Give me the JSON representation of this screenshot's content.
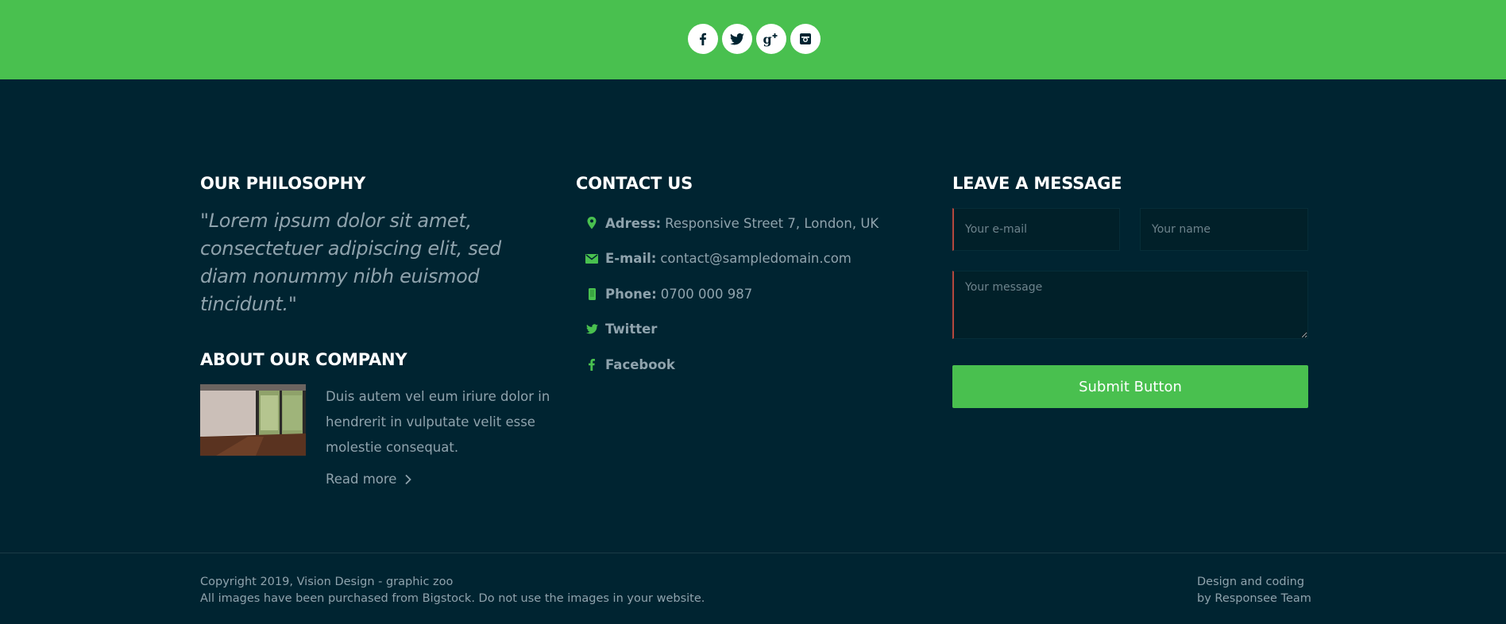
{
  "social": {
    "icons": [
      "facebook-icon",
      "twitter-icon",
      "google-plus-icon",
      "instagram-icon"
    ]
  },
  "philosophy": {
    "title": "OUR PHILOSOPHY",
    "quote": "\"Lorem ipsum dolor sit amet, consectetuer adipiscing elit, sed diam nonummy nibh euismod tincidunt.\""
  },
  "about": {
    "title": "ABOUT OUR COMPANY",
    "text": "Duis autem vel eum iriure dolor in hendrerit in vulputate velit esse molestie consequat.",
    "read_more": "Read more"
  },
  "contact": {
    "title": "CONTACT US",
    "address_label": "Adress:",
    "address_value": "Responsive Street 7, London, UK",
    "email_label": "E-mail:",
    "email_value": "contact@sampledomain.com",
    "phone_label": "Phone:",
    "phone_value": "0700 000 987",
    "twitter": "Twitter",
    "facebook": "Facebook"
  },
  "message": {
    "title": "LEAVE A MESSAGE",
    "email_placeholder": "Your e-mail",
    "name_placeholder": "Your name",
    "message_placeholder": "Your message",
    "submit": "Submit Button"
  },
  "bottom": {
    "copyright_line1": "Copyright 2019, Vision Design - graphic zoo",
    "copyright_line2": "All images have been purchased from Bigstock. Do not use the images in your website.",
    "credits_line1": "Design and coding",
    "credits_line2": "by Responsee Team"
  },
  "colors": {
    "accent": "#49c04f",
    "background": "#002431",
    "text": "#8fa3ad",
    "invalid": "#b5473d"
  }
}
